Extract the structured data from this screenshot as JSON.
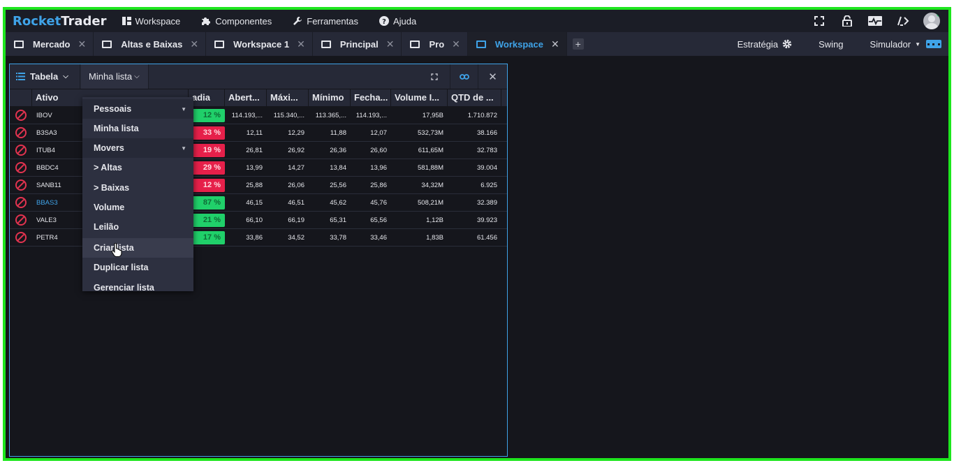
{
  "app": {
    "logo_part1": "Rocket",
    "logo_part2": "Trader",
    "menu": [
      {
        "label": "Workspace",
        "icon": "workspace-icon"
      },
      {
        "label": "Componentes",
        "icon": "puzzle-icon"
      },
      {
        "label": "Ferramentas",
        "icon": "wrench-icon"
      },
      {
        "label": "Ajuda",
        "icon": "help-icon"
      }
    ]
  },
  "tabs": [
    {
      "label": "Mercado",
      "active": false
    },
    {
      "label": "Altas e Baixas",
      "active": false
    },
    {
      "label": "Workspace 1",
      "active": false
    },
    {
      "label": "Principal",
      "active": false
    },
    {
      "label": "Pro",
      "active": false
    },
    {
      "label": "Workspace",
      "active": true
    }
  ],
  "tabbar_right": {
    "estrategia": "Estratégia",
    "swing": "Swing",
    "simulador": "Simulador"
  },
  "panel": {
    "view_label": "Tabela",
    "list_label": "Minha lista"
  },
  "table": {
    "columns": [
      "Ativo",
      "adia",
      "Abert...",
      "Máxi...",
      "Mínimo",
      "Fecha...",
      "Volume I...",
      "QTD de ..."
    ],
    "rows": [
      {
        "ativo": "IBOV",
        "pct": "12 %",
        "dir": "up",
        "abertura": "114.193,...",
        "maxima": "115.340,...",
        "minimo": "113.365,...",
        "fechamento": "114.193,...",
        "volume": "17,95B",
        "qtd": "1.710.872",
        "highlight": false
      },
      {
        "ativo": "B3SA3",
        "pct": "33 %",
        "dir": "down",
        "abertura": "12,11",
        "maxima": "12,29",
        "minimo": "11,88",
        "fechamento": "12,07",
        "volume": "532,73M",
        "qtd": "38.166",
        "highlight": false
      },
      {
        "ativo": "ITUB4",
        "pct": "19 %",
        "dir": "down",
        "abertura": "26,81",
        "maxima": "26,92",
        "minimo": "26,36",
        "fechamento": "26,60",
        "volume": "611,65M",
        "qtd": "32.783",
        "highlight": false
      },
      {
        "ativo": "BBDC4",
        "pct": "29 %",
        "dir": "down",
        "abertura": "13,99",
        "maxima": "14,27",
        "minimo": "13,84",
        "fechamento": "13,96",
        "volume": "581,88M",
        "qtd": "39.004",
        "highlight": false
      },
      {
        "ativo": "SANB11",
        "pct": "12 %",
        "dir": "down",
        "abertura": "25,88",
        "maxima": "26,06",
        "minimo": "25,56",
        "fechamento": "25,86",
        "volume": "34,32M",
        "qtd": "6.925",
        "highlight": false
      },
      {
        "ativo": "BBAS3",
        "pct": "87 %",
        "dir": "up",
        "abertura": "46,15",
        "maxima": "46,51",
        "minimo": "45,62",
        "fechamento": "45,76",
        "volume": "508,21M",
        "qtd": "32.389",
        "highlight": true
      },
      {
        "ativo": "VALE3",
        "pct": "21 %",
        "dir": "up",
        "abertura": "66,10",
        "maxima": "66,19",
        "minimo": "65,31",
        "fechamento": "65,56",
        "volume": "1,12B",
        "qtd": "39.923",
        "highlight": false
      },
      {
        "ativo": "PETR4",
        "pct": "17 %",
        "dir": "up",
        "abertura": "33,86",
        "maxima": "34,52",
        "minimo": "33,78",
        "fechamento": "33,46",
        "volume": "1,83B",
        "qtd": "61.456",
        "highlight": false
      }
    ]
  },
  "dropdown": {
    "items": [
      {
        "label": "Pessoais",
        "type": "header"
      },
      {
        "label": "Minha lista",
        "type": "item"
      },
      {
        "label": "Movers",
        "type": "header"
      },
      {
        "label": "> Altas",
        "type": "item"
      },
      {
        "label": "> Baixas",
        "type": "item"
      },
      {
        "label": "Volume",
        "type": "item"
      },
      {
        "label": "Leilão",
        "type": "item"
      },
      {
        "label": "Criar lista",
        "type": "hover"
      },
      {
        "label": "Duplicar lista",
        "type": "item"
      },
      {
        "label": "Gerenciar lista",
        "type": "item"
      }
    ]
  },
  "colors": {
    "accent": "#3fa3e8",
    "up": "#20d06a",
    "down": "#e6204a",
    "frame": "#1ee61e"
  }
}
